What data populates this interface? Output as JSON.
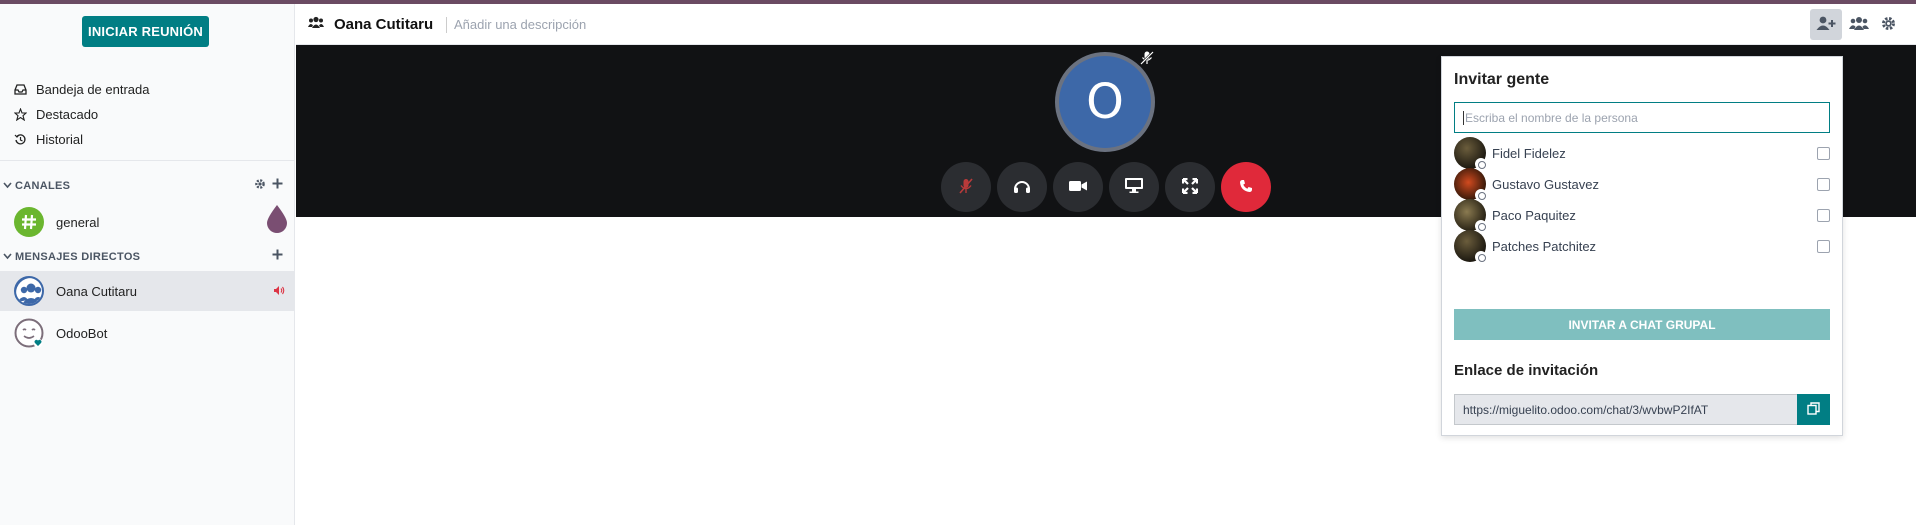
{
  "sidebar": {
    "start_meeting": "INICIAR REUNIÓN",
    "mailboxes": [
      {
        "label": "Bandeja de entrada",
        "icon": "inbox-icon"
      },
      {
        "label": "Destacado",
        "icon": "star-icon"
      },
      {
        "label": "Historial",
        "icon": "history-icon"
      }
    ],
    "channels_header": "CANALES",
    "channels": [
      {
        "label": "general",
        "icon": "hashtag-icon"
      }
    ],
    "dm_header": "MENSAJES DIRECTOS",
    "direct_messages": [
      {
        "label": "Oana Cutitaru",
        "active": true
      },
      {
        "label": "OdooBot",
        "active": false
      }
    ]
  },
  "header": {
    "title": "Oana Cutitaru",
    "description_placeholder": "Añadir una descripción"
  },
  "call": {
    "avatar_letter": "O"
  },
  "invite": {
    "title": "Invitar gente",
    "search_placeholder": "Escriba el nombre de la persona",
    "people": [
      {
        "name": "Fidel Fidelez"
      },
      {
        "name": "Gustavo Gustavez"
      },
      {
        "name": "Paco Paquitez"
      },
      {
        "name": "Patches Patchitez"
      }
    ],
    "group_button": "INVITAR A CHAT GRUPAL",
    "link_title": "Enlace de invitación",
    "link_value": "https://miguelito.odoo.com/chat/3/wvbwP2IfAT"
  },
  "colors": {
    "brand": "#017e84",
    "top_bar": "#6b4b63",
    "hangup": "#e0293a",
    "call_bg": "#111214"
  }
}
